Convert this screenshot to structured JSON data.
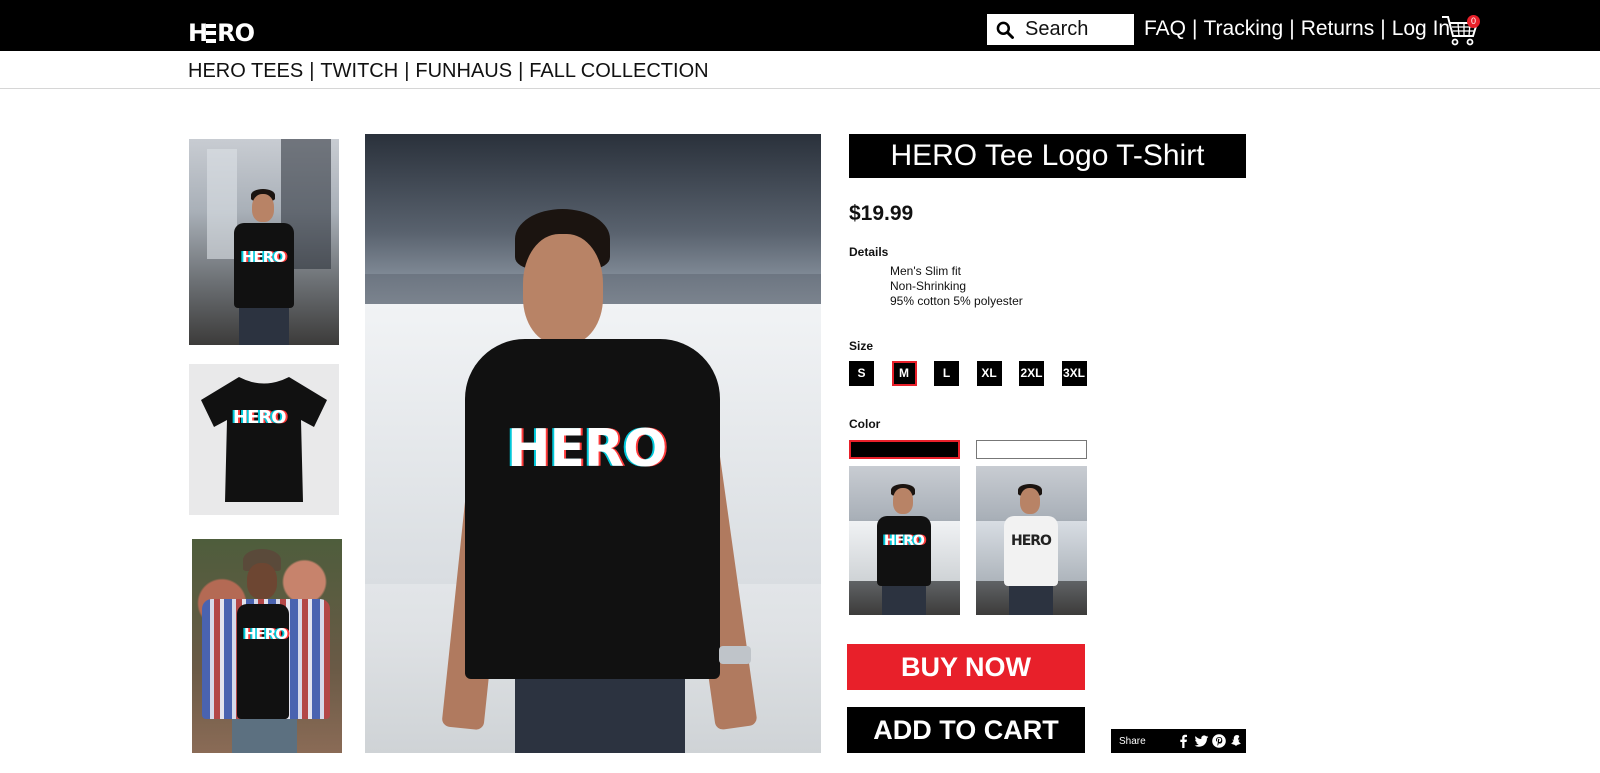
{
  "header": {
    "logo": "HERO",
    "search_placeholder": "Search",
    "links": [
      "FAQ",
      "Tracking",
      "Returns",
      "Log In"
    ],
    "cart_count": "0"
  },
  "catnav": {
    "items": [
      "HERO TEES",
      "TWITCH",
      "FUNHAUS",
      "FALL COLLECTION"
    ]
  },
  "thumbnails": [
    "model-street-thumbnail",
    "shirt-flat-thumbnail",
    "model-garden-thumbnail"
  ],
  "product": {
    "title": "HERO Tee Logo T-Shirt",
    "price": "$19.99",
    "details_label": "Details",
    "details": [
      "Men's Slim fit",
      "Non-Shrinking",
      "95% cotton 5% polyester"
    ],
    "size_label": "Size",
    "sizes": [
      "S",
      "M",
      "L",
      "XL",
      "2XL",
      "3XL"
    ],
    "selected_size": "M",
    "color_label": "Color",
    "colors": [
      "#000000",
      "#ffffff"
    ],
    "selected_color": "#000000",
    "shirt_logo": "HERO",
    "buy_now": "BUY NOW",
    "add_to_cart": "ADD TO CART"
  },
  "share": {
    "label": "Share",
    "icons": [
      "facebook-icon",
      "twitter-icon",
      "pinterest-icon",
      "snapchat-icon"
    ]
  },
  "colors": {
    "accent_red": "#e8202a",
    "header_bg": "#000000"
  }
}
